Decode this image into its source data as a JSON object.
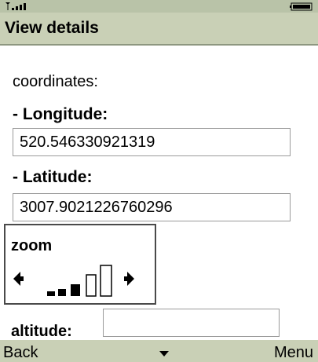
{
  "window": {
    "title": "View details"
  },
  "content": {
    "coordinates_label": "coordinates:",
    "longitude_label": "- Longitude:",
    "longitude_value": "520.546330921319",
    "latitude_label": "- Latitude:",
    "latitude_value": "3007.9021226760296",
    "zoom_label": "zoom",
    "zoom_level": 3,
    "zoom_levels_total": 5,
    "altitude_label": "altitude:",
    "altitude_value": ""
  },
  "softkeys": {
    "left": "Back",
    "right": "Menu"
  },
  "icons": {
    "signal": "signal-strength-icon",
    "battery": "battery-icon",
    "zoom_left": "arrow-left-icon",
    "zoom_right": "arrow-right-icon",
    "scroll": "scroll-down-icon"
  },
  "colors": {
    "status_bar": "#b9c3a8",
    "title_bar": "#c9d0b6",
    "softkey_bar": "#c9d0b6"
  }
}
